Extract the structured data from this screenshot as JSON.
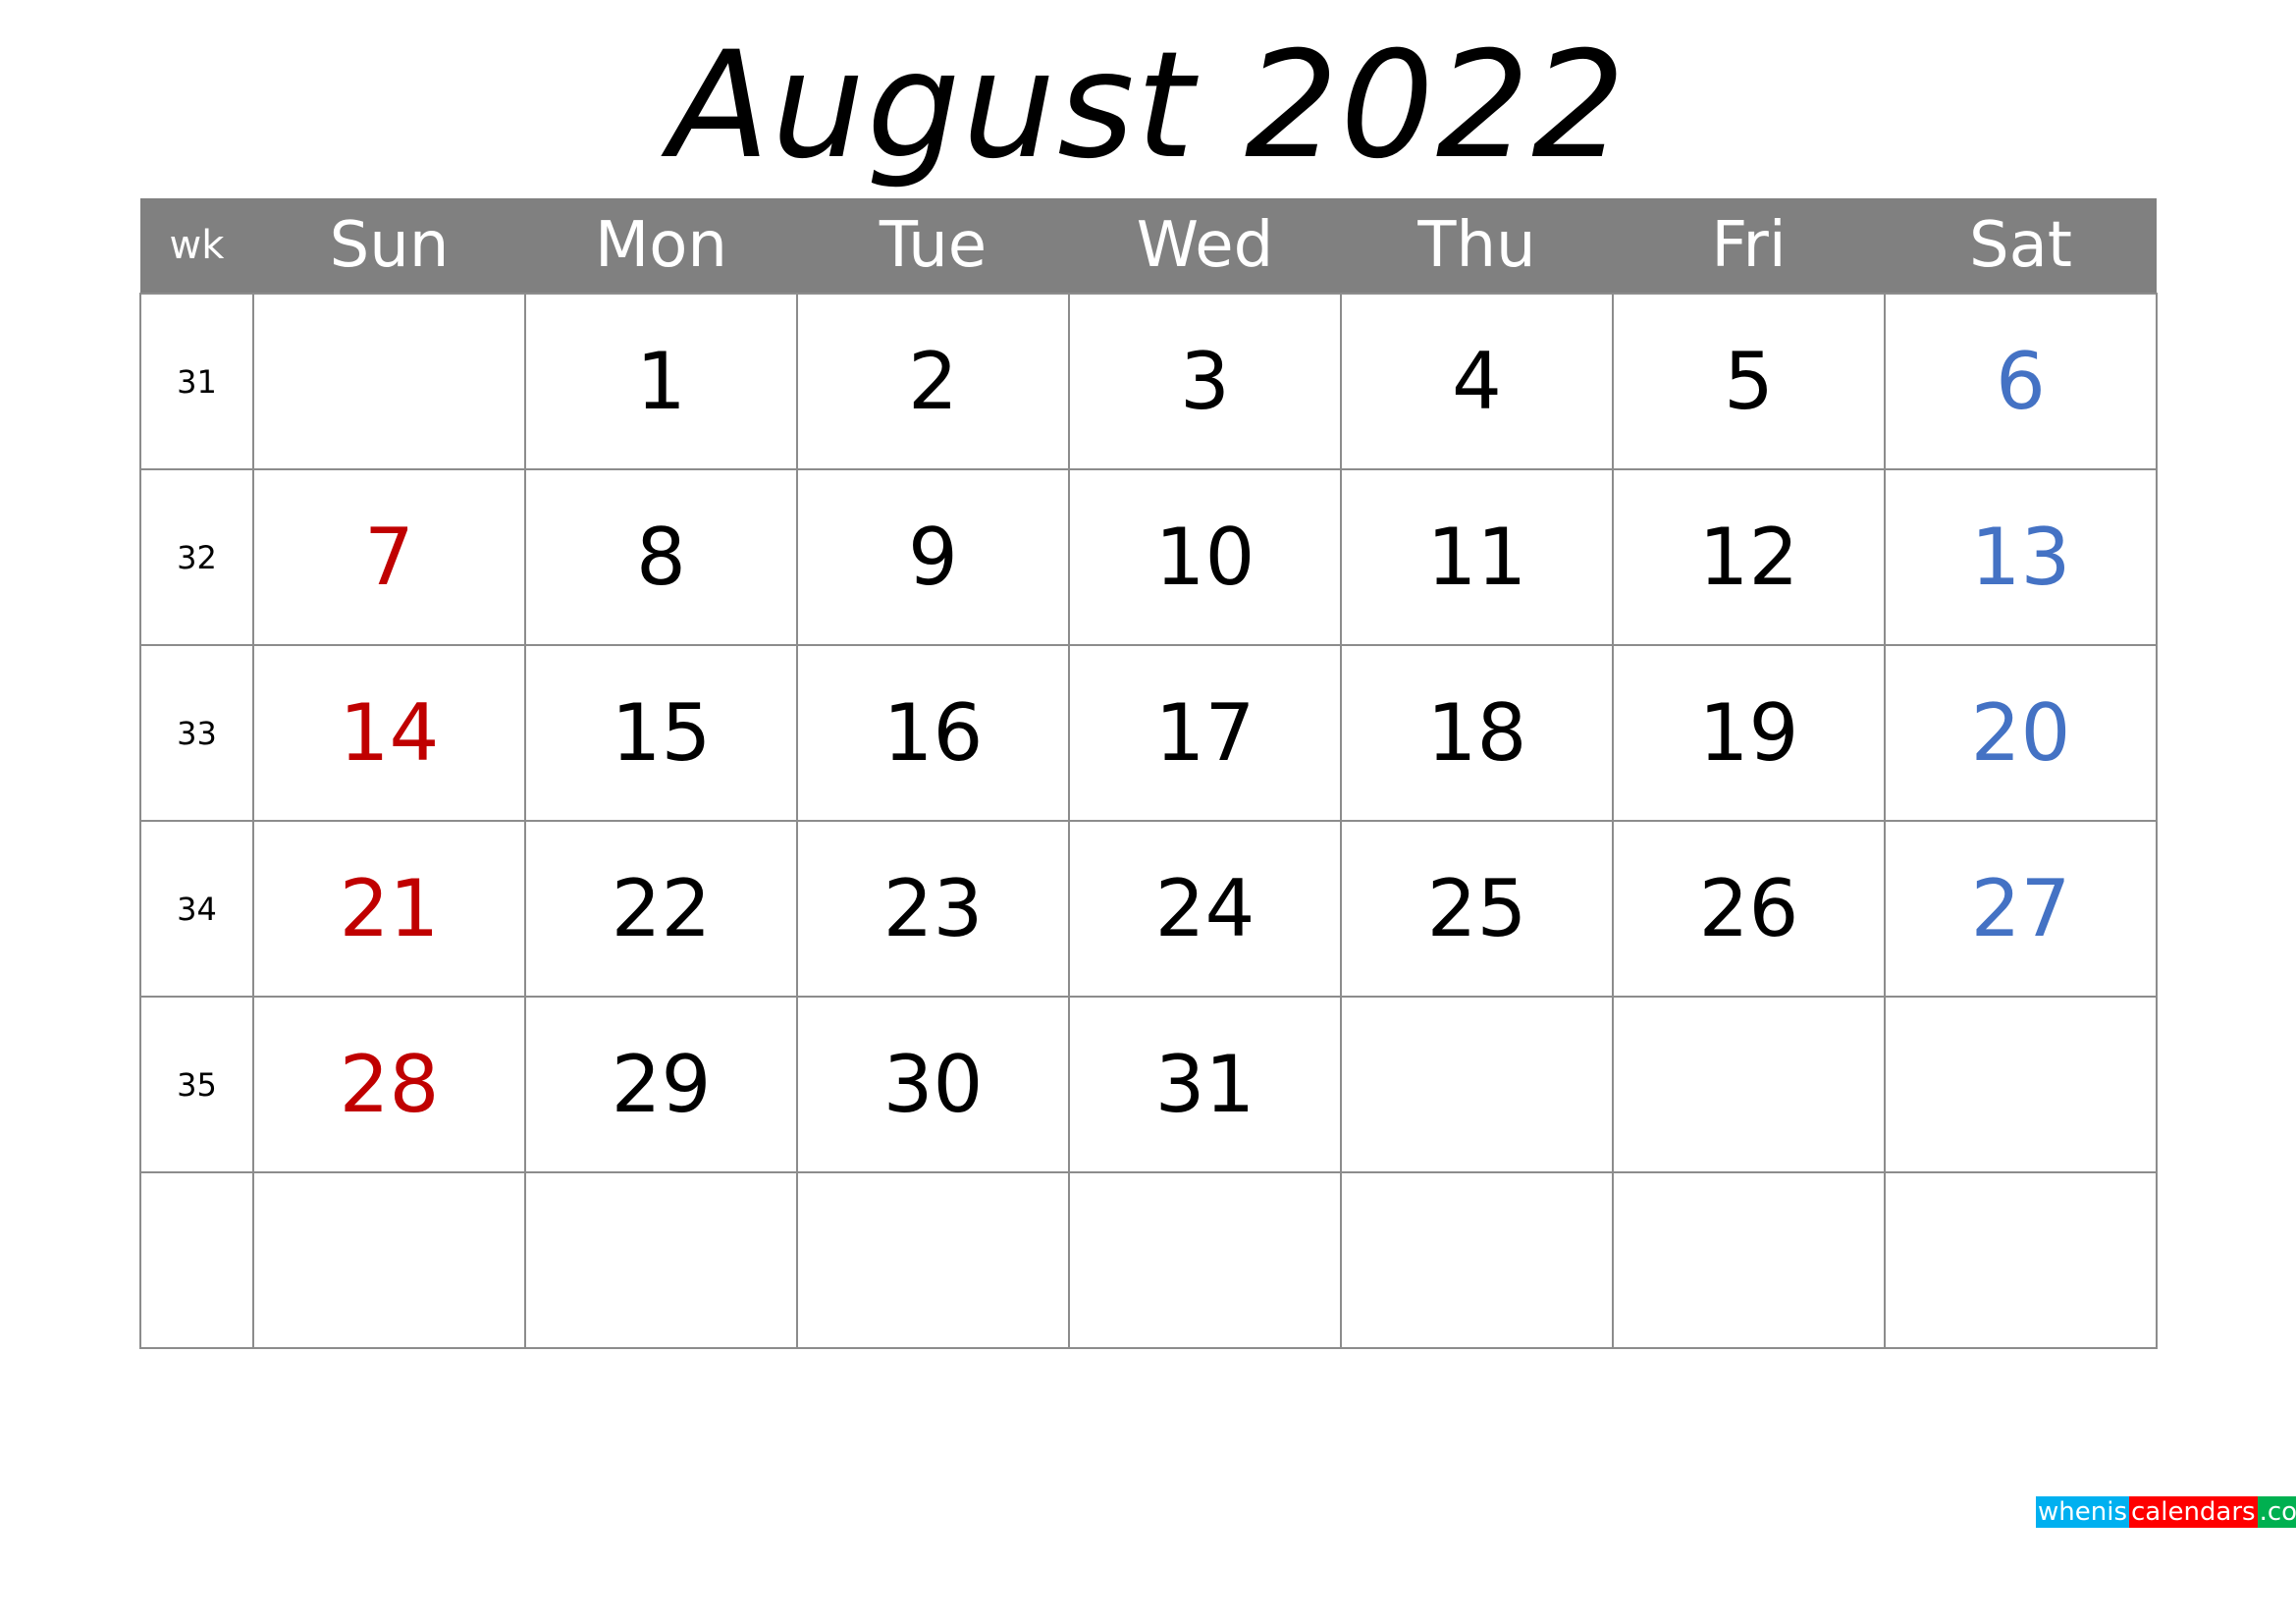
{
  "title": "August 2022",
  "header": {
    "wk_label": "wk",
    "days": [
      "Sun",
      "Mon",
      "Tue",
      "Wed",
      "Thu",
      "Fri",
      "Sat"
    ]
  },
  "colors": {
    "header_bg": "#808080",
    "sunday": "#C00000",
    "saturday": "#4472C4",
    "weekday": "#000000"
  },
  "weeks": [
    {
      "wk": "31",
      "days": [
        "",
        "1",
        "2",
        "3",
        "4",
        "5",
        "6"
      ]
    },
    {
      "wk": "32",
      "days": [
        "7",
        "8",
        "9",
        "10",
        "11",
        "12",
        "13"
      ]
    },
    {
      "wk": "33",
      "days": [
        "14",
        "15",
        "16",
        "17",
        "18",
        "19",
        "20"
      ]
    },
    {
      "wk": "34",
      "days": [
        "21",
        "22",
        "23",
        "24",
        "25",
        "26",
        "27"
      ]
    },
    {
      "wk": "35",
      "days": [
        "28",
        "29",
        "30",
        "31",
        "",
        "",
        ""
      ]
    },
    {
      "wk": "",
      "days": [
        "",
        "",
        "",
        "",
        "",
        "",
        ""
      ]
    }
  ],
  "logo": {
    "part1": "whenis",
    "part2": "calendars",
    "part3": ".com"
  }
}
